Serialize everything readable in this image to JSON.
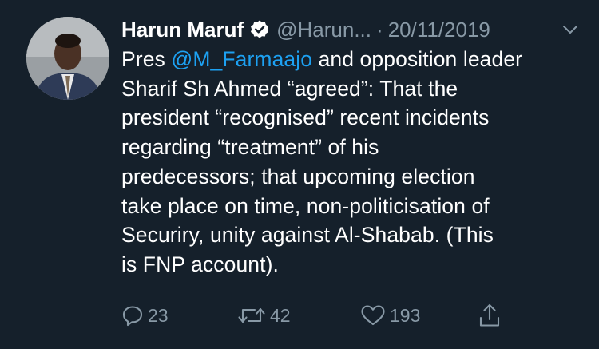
{
  "tweet": {
    "author": {
      "display_name": "Harun Maruf",
      "handle": "@Harun...",
      "verified": true,
      "avatar_icon": "profile-photo"
    },
    "separator": "·",
    "date": "20/11/2019",
    "menu_icon": "chevron-down-icon",
    "body": {
      "line1_prefix": "Pres ",
      "mention": "@M_Farmaajo",
      "line1_suffix": " and opposition leader",
      "lines": [
        "Sharif Sh Ahmed “agreed”: That the",
        "president “recognised” recent incidents",
        "regarding “treatment” of his",
        "predecessors; that upcoming election",
        "take place on time, non-politicisation of",
        "Securiry, unity against Al-Shabab. (This",
        "is FNP account)."
      ]
    },
    "actions": {
      "reply_count": "23",
      "retweet_count": "42",
      "like_count": "193"
    }
  },
  "colors": {
    "background": "#15202b",
    "text": "#ffffff",
    "secondary": "#8899a6",
    "link": "#1da1f2"
  }
}
